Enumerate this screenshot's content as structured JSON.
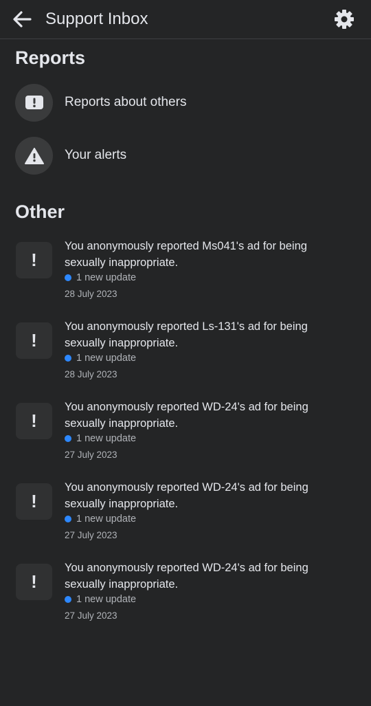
{
  "header": {
    "title": "Support Inbox",
    "back_icon": "arrow-left-icon",
    "settings_icon": "gear-icon"
  },
  "reports": {
    "title": "Reports",
    "items": [
      {
        "label": "Reports about others",
        "icon": "exclamation-box-icon"
      },
      {
        "label": "Your alerts",
        "icon": "warning-triangle-icon"
      }
    ]
  },
  "other": {
    "title": "Other",
    "items": [
      {
        "icon_glyph": "!",
        "message": "You anonymously reported Ms041's ad for being sexually inappropriate.",
        "update": "1 new update",
        "date": "28 July 2023"
      },
      {
        "icon_glyph": "!",
        "message": "You anonymously reported Ls-131's ad for being sexually inappropriate.",
        "update": "1 new update",
        "date": "28 July 2023"
      },
      {
        "icon_glyph": "!",
        "message": "You anonymously reported WD-24's ad for being sexually inappropriate.",
        "update": "1 new update",
        "date": "27 July 2023"
      },
      {
        "icon_glyph": "!",
        "message": "You anonymously reported WD-24's ad for being sexually inappropriate.",
        "update": "1 new update",
        "date": "27 July 2023"
      },
      {
        "icon_glyph": "!",
        "message": "You anonymously reported WD-24's ad for being sexually inappropriate.",
        "update": "1 new update",
        "date": "27 July 2023"
      }
    ]
  },
  "colors": {
    "background": "#242526",
    "text": "#e4e6eb",
    "secondary_text": "#b0b3b8",
    "unread_dot": "#2d88ff"
  }
}
